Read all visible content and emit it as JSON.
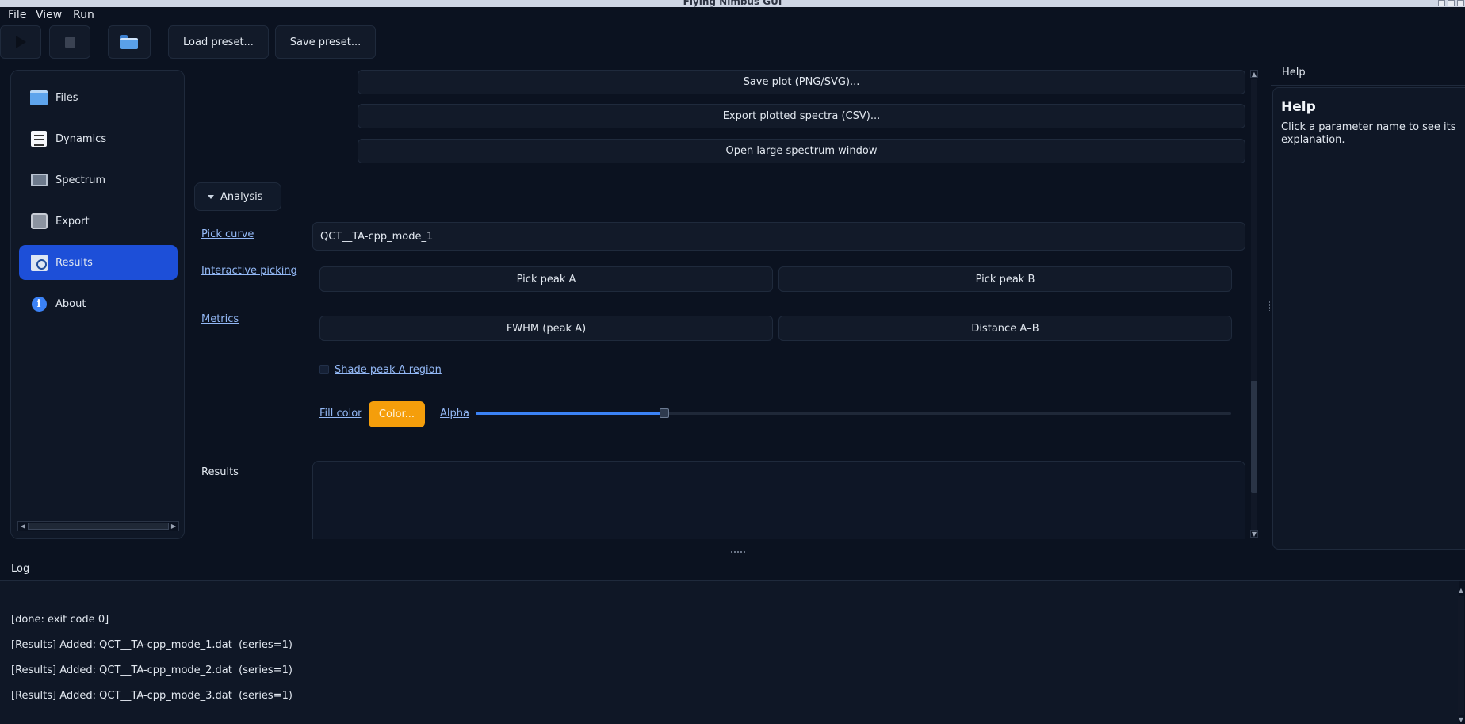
{
  "window": {
    "title": "Flying Nimbus GUI"
  },
  "menu": {
    "file": "File",
    "view": "View",
    "run": "Run"
  },
  "toolbar": {
    "load_preset": "Load preset...",
    "save_preset": "Save preset..."
  },
  "sidebar": {
    "items": [
      {
        "label": "Files",
        "icon": "folder-icon"
      },
      {
        "label": "Dynamics",
        "icon": "document-icon"
      },
      {
        "label": "Spectrum",
        "icon": "monitor-icon"
      },
      {
        "label": "Export",
        "icon": "drive-icon"
      },
      {
        "label": "Results",
        "icon": "results-icon",
        "active": true
      },
      {
        "label": "About",
        "icon": "info-icon"
      }
    ]
  },
  "plot_actions": {
    "save_plot": "Save plot (PNG/SVG)...",
    "export_spectra": "Export plotted spectra (CSV)...",
    "open_large": "Open large spectrum window"
  },
  "analysis": {
    "section_label": "Analysis",
    "pick_curve_label": "Pick curve",
    "pick_curve_value": "QCT__TA-cpp_mode_1",
    "interactive_picking_label": "Interactive picking",
    "pick_peak_a": "Pick peak A",
    "pick_peak_b": "Pick peak B",
    "metrics_label": "Metrics",
    "fwhm": "FWHM (peak A)",
    "distance": "Distance A–B",
    "shade_label": "Shade peak A region",
    "shade_checked": false,
    "fill_color_label": "Fill color",
    "color_button": "Color...",
    "fill_color": "#f59e0b",
    "alpha_label": "Alpha",
    "alpha_value": 0.25,
    "results_label": "Results"
  },
  "help": {
    "tab_label": "Help",
    "title": "Help",
    "text": "Click a parameter name to see its explanation."
  },
  "log": {
    "header": "Log",
    "lines": [
      "[done: exit code 0]",
      "[Results] Added: QCT__TA-cpp_mode_1.dat  (series=1)",
      "[Results] Added: QCT__TA-cpp_mode_2.dat  (series=1)",
      "[Results] Added: QCT__TA-cpp_mode_3.dat  (series=1)"
    ]
  },
  "colors": {
    "accent": "#1d4fd8",
    "background": "#0b1220",
    "link": "#93b8f5"
  }
}
